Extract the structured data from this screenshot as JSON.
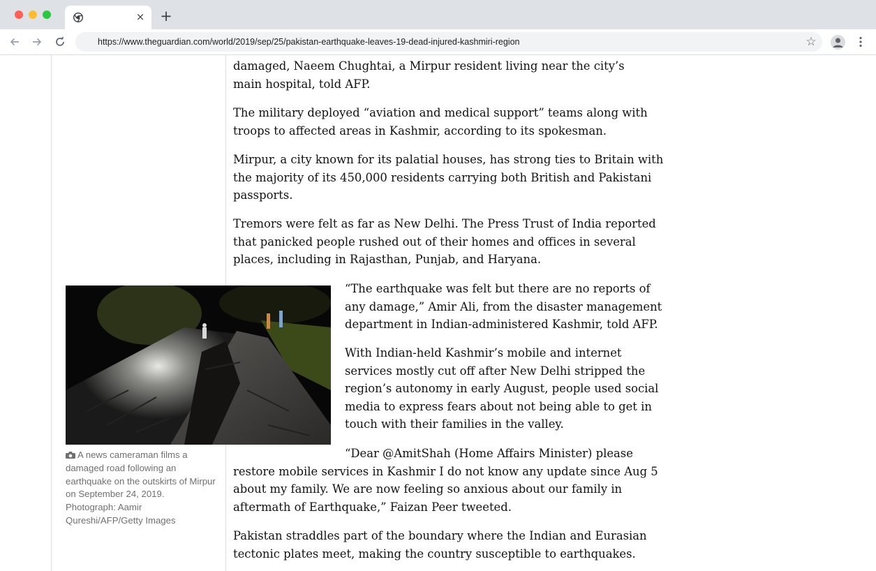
{
  "browser": {
    "tab_close": "×",
    "new_tab": "+",
    "url": "https://www.theguardian.com/world/2019/sep/25/pakistan-earthquake-leaves-19-dead-injured-kashmiri-region",
    "bookmark_star": "☆"
  },
  "article": {
    "paragraphs": [
      "damaged, Naeem Chughtai, a Mirpur resident living near the city’s main hospital, told AFP.",
      "The military deployed “aviation and medical support” teams along with troops to affected areas in Kashmir, according to its spokesman.",
      "Mirpur, a city known for its palatial houses, has strong ties to Britain with the majority of its 450,000 residents carrying both British and Pakistani passports.",
      "Tremors were felt as far as New Delhi. The Press Trust of India reported that panicked people rushed out of their homes and offices in several places, including in Rajasthan, Punjab, and Haryana.",
      "“The earthquake was felt but there are no reports of any damage,” Amir Ali, from the disaster management department in Indian-administered Kashmir, told AFP.",
      "With Indian-held Kashmir’s mobile and internet services mostly cut off after New Delhi stripped the region’s autonomy in early August, people used social media to express fears about not being able to get in touch with their families in the valley.",
      "“Dear @AmitShah (Home Affairs Minister) please restore mobile services in Kashmir I do not know any update since Aug 5 about my family. We are now feeling so anxious about our family in aftermath of Earthquake,” Faizan Peer tweeted.",
      "Pakistan straddles part of the boundary where the Indian and Eurasian tectonic plates meet, making the country susceptible to earthquakes."
    ]
  },
  "figure": {
    "caption": "A news cameraman films a damaged road following an earthquake on the outskirts of Mirpur on September 24, 2019. Photograph: Aamir Qureshi/AFP/Getty Images"
  },
  "icons": [
    "back-arrow-icon",
    "forward-arrow-icon",
    "reload-icon",
    "chrome-icon",
    "star-icon",
    "profile-icon",
    "kebab-menu-icon",
    "camera-icon"
  ]
}
